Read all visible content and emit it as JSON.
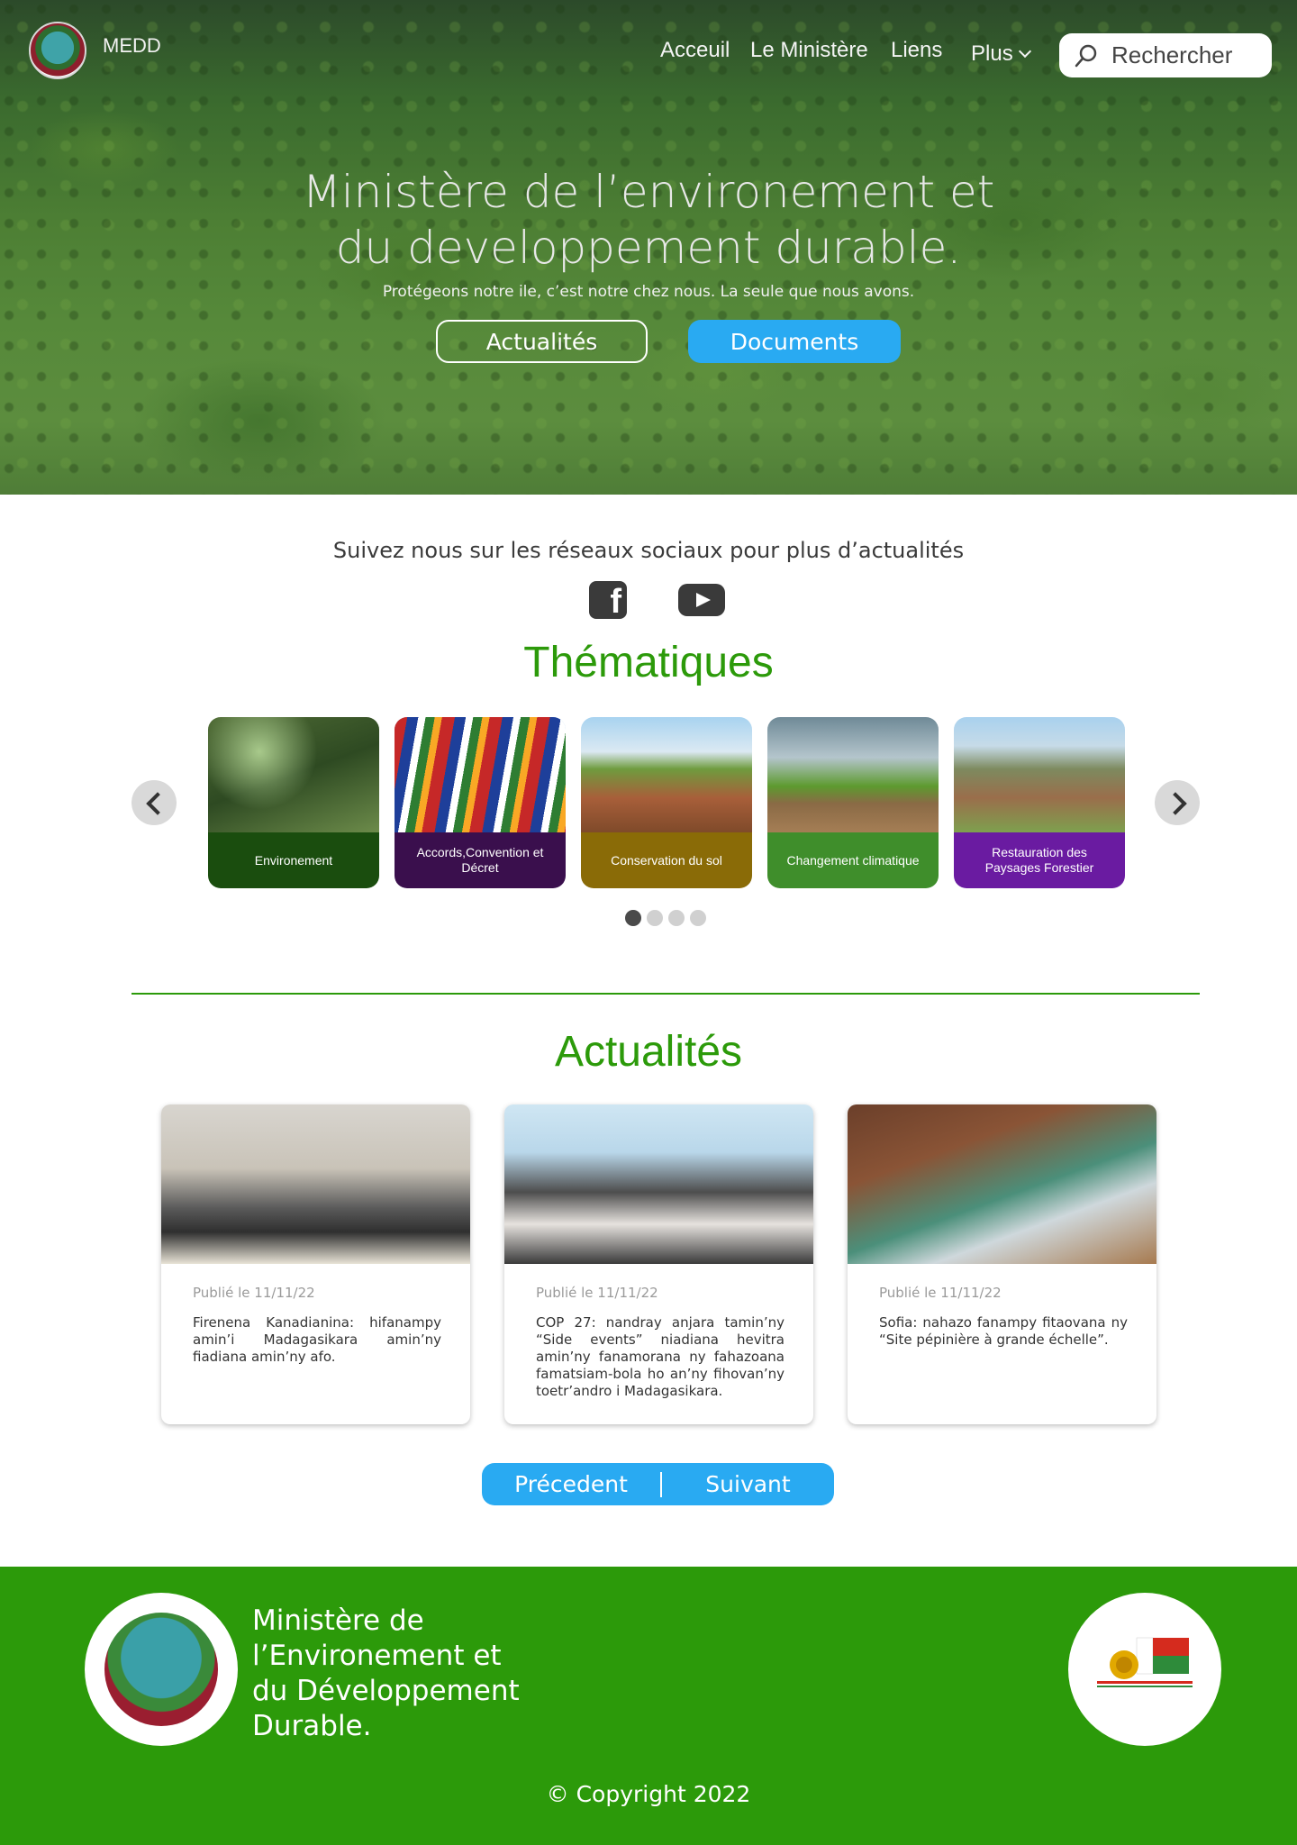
{
  "header": {
    "brand": "MEDD",
    "nav": [
      "Acceuil",
      "Le Ministère",
      "Liens",
      "Plus"
    ],
    "search_label": "Rechercher"
  },
  "hero": {
    "title": "Ministère de l’environement et\ndu developpement durable.",
    "subtitle": "Protégeons notre ile, c’est notre chez nous. La seule que nous avons.",
    "btn_actualites": "Actualités",
    "btn_documents": "Documents"
  },
  "social": {
    "text": "Suivez nous sur les réseaux sociaux pour plus d’actualités",
    "icons": [
      "facebook-icon",
      "youtube-icon"
    ]
  },
  "thematiques": {
    "title": "Thématiques",
    "items": [
      {
        "label": "Environement",
        "color": "#1a4d0e"
      },
      {
        "label": "Accords,Convention et Décret",
        "color": "#3a0f4d"
      },
      {
        "label": "Conservation du sol",
        "color": "#8a6b07"
      },
      {
        "label": "Changement climatique",
        "color": "#3f8e2b"
      },
      {
        "label": "Restauration des Paysages Forestier",
        "color": "#6a1ba1"
      }
    ],
    "pages": 4,
    "active_page": 1
  },
  "actualites": {
    "title": "Actualités",
    "items": [
      {
        "date": "Publié le 11/11/22",
        "text": "Firenena Kanadianina: hifanampy amin’i Madagasikara amin’ny fiadiana amin’ny afo."
      },
      {
        "date": "Publié le 11/11/22",
        "text": "COP 27: nandray anjara tamin’ny “Side events” niadiana hevitra amin’ny fanamorana ny fahazoana famatsiam-bola ho an’ny fihovan’ny toetr’andro i Madagasikara."
      },
      {
        "date": "Publié le 11/11/22",
        "text": "Sofia: nahazo fanampy fitaovana ny “Site pépinière à grande échelle”."
      }
    ],
    "prev_label": "Précedent",
    "next_label": "Suivant"
  },
  "footer": {
    "title": "Ministère de\nl’Environement et\ndu Développement\nDurable.",
    "copyright": "© Copyright 2022"
  },
  "colors": {
    "accent_green": "#2c9a0a",
    "accent_blue": "#29aaf2"
  }
}
